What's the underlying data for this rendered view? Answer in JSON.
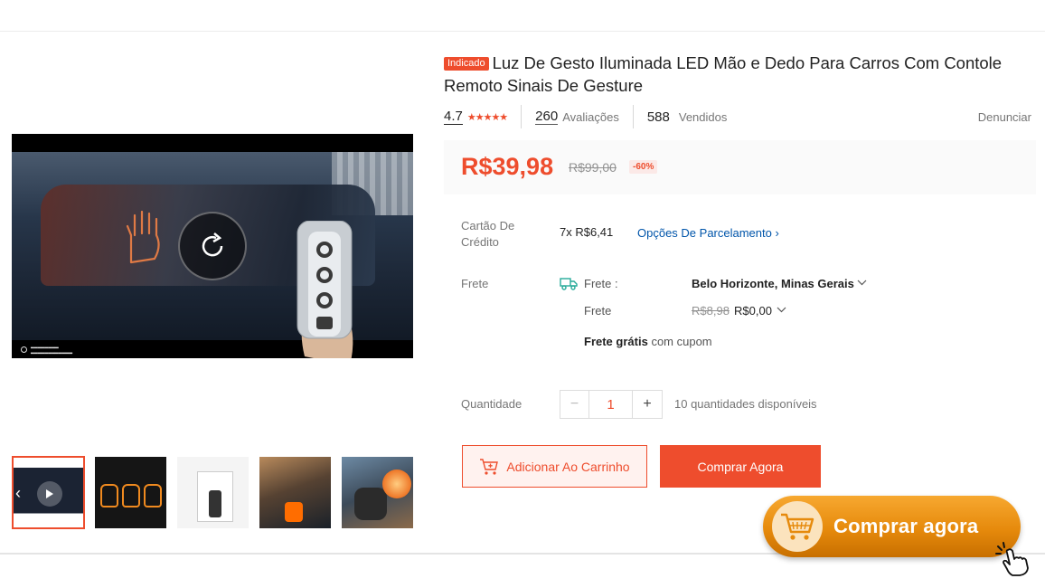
{
  "product": {
    "badge": "Indicado",
    "title": "Luz De Gesto Iluminada LED Mão e Dedo Para Carros Com Contole Remoto Sinais De Gesture"
  },
  "stats": {
    "rating": "4.7",
    "stars": "★★★★★",
    "reviews_count": "260",
    "reviews_label": "Avaliações",
    "sold_count": "588",
    "sold_label": "Vendidos",
    "report": "Denunciar"
  },
  "price": {
    "current": "R$39,98",
    "original": "R$99,00",
    "discount": "-60%"
  },
  "payment": {
    "label": "Cartão De Crédito",
    "installments": "7x R$6,41",
    "options_link": "Opções De Parcelamento ›"
  },
  "shipping": {
    "label": "Frete",
    "to_label": "Frete :",
    "location": "Belo Horizonte, Minas Gerais",
    "cost_label": "Frete",
    "old_cost": "R$8,98",
    "new_cost": "R$0,00",
    "free_bold": "Frete grátis",
    "free_suffix": "com cupom"
  },
  "quantity": {
    "label": "Quantidade",
    "value": "1",
    "available": "10 quantidades disponíveis"
  },
  "buttons": {
    "add_to_cart": "Adicionar Ao Carrinho",
    "buy_now": "Comprar Agora",
    "cta": "Comprar agora"
  },
  "colors": {
    "accent": "#ee4d2d",
    "cta": "#e68a0c",
    "link": "#0055aa"
  },
  "icons": [
    "play-replay-icon",
    "star-icon",
    "truck-icon",
    "chevron-down-icon",
    "cart-icon",
    "pointer-hand-icon"
  ]
}
